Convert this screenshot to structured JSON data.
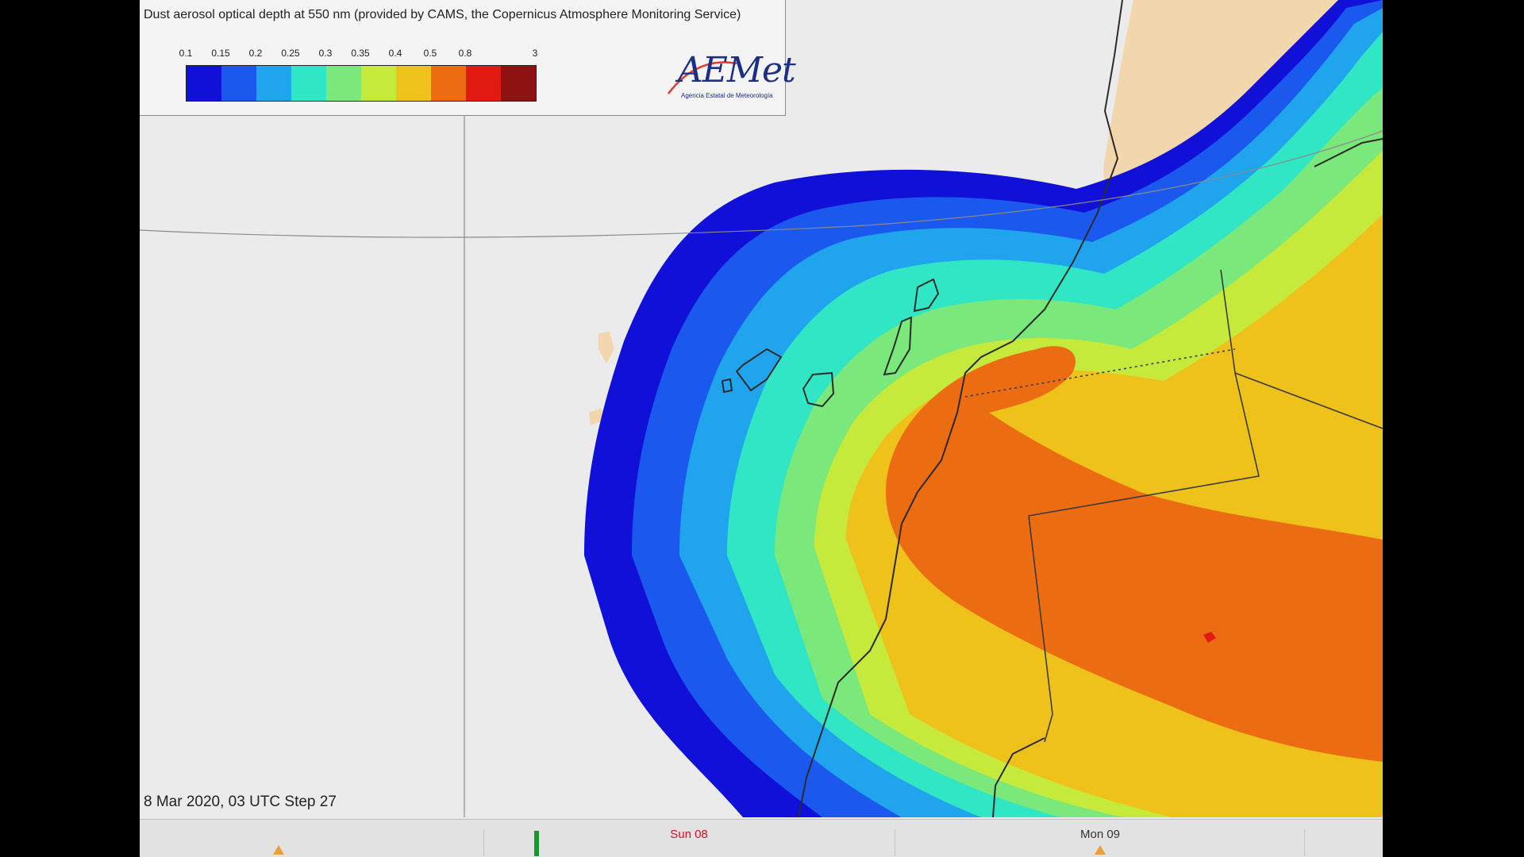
{
  "legend": {
    "title": "Dust aerosol optical depth at 550 nm (provided by CAMS, the Copernicus Atmosphere Monitoring Service)",
    "tick_labels": [
      "0.1",
      "0.15",
      "0.2",
      "0.25",
      "0.3",
      "0.35",
      "0.4",
      "0.5",
      "0.8",
      "3"
    ],
    "colors": [
      "#1010d8",
      "#1a58ee",
      "#20a4ee",
      "#30e6c4",
      "#7ae87a",
      "#c6ea3c",
      "#eec21a",
      "#ec6c12",
      "#e21a12",
      "#8e1212"
    ]
  },
  "logo": {
    "word": "AEMet",
    "subtitle": "Agencia Estatal de Meteorología"
  },
  "timestamp": "8 Mar 2020, 03 UTC Step 27",
  "timeline": {
    "day1": "Sun 08",
    "day2": "Mon 09",
    "current_marker": "green-cursor"
  },
  "colors": {
    "land": "#f2d7ae",
    "sea": "#ebebeb",
    "coast": "#2b2b2b",
    "current_day": "#d4141a"
  }
}
